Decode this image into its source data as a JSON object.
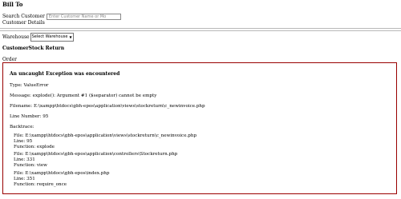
{
  "header": {
    "bill_to": "Bill To",
    "search_label": "Search Customer",
    "search_placeholder": "Enter Customer Name or Mo",
    "customer_details": "Customer Details"
  },
  "warehouse": {
    "label": "Warehouse",
    "selected": "Select Warehouse"
  },
  "section": {
    "title": "CustomerStock Return",
    "order_label": "Order"
  },
  "error": {
    "title": "An uncaught Exception was encountered",
    "type": "Type: ValueError",
    "message": "Message: explode(): Argument #1 ($separator) cannot be empty",
    "filename": "Filename: E:\\xampp\\htdocs\\gbh-epos\\application\\views\\stockreturn\\c_newinvoice.php",
    "line_number": "Line Number: 95",
    "backtrace_label": "Backtrace:",
    "backtrace": [
      {
        "file": "File: E:\\xampp\\htdocs\\gbh-epos\\application\\views\\stockreturn\\c_newinvoice.php",
        "line": "Line: 95",
        "function": "Function: explode"
      },
      {
        "file": "File: E:\\xampp\\htdocs\\gbh-epos\\application\\controllers\\Stockreturn.php",
        "line": "Line: 331",
        "function": "Function: view"
      },
      {
        "file": "File: E:\\xampp\\htdocs\\gbh-epos\\index.php",
        "line": "Line: 351",
        "function": "Function: require_once"
      }
    ]
  },
  "colors": {
    "error_border": "#990000"
  },
  "icons": {
    "select_chevron": "chevron-down-icon"
  }
}
